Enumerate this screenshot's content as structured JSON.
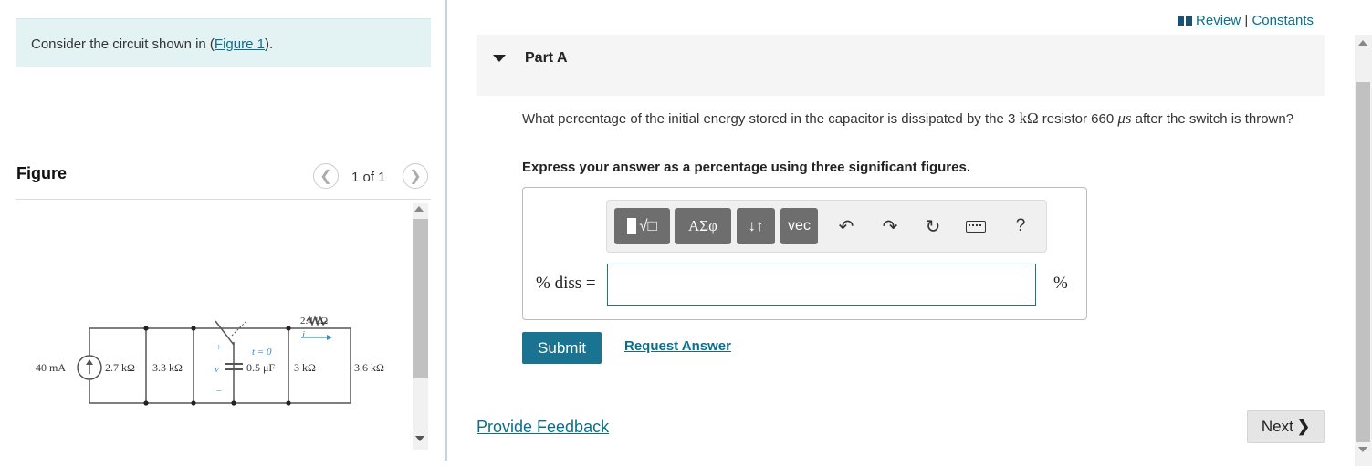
{
  "intro": {
    "prefix": "Consider the circuit shown in (",
    "link": "Figure 1",
    "suffix": ")."
  },
  "figure": {
    "title": "Figure",
    "count": "1 of 1",
    "prev_icon": "chevron-left-icon",
    "next_icon": "chevron-right-icon",
    "circuit": {
      "source": "40 mA",
      "r1": "2.7 kΩ",
      "r2": "3.3 kΩ",
      "r3": "2.4 kΩ",
      "cap": "0.5 μF",
      "r4": "3 kΩ",
      "r5": "3.6 kΩ",
      "time": "t = 0",
      "current": "i",
      "voltage": "v",
      "plus": "+",
      "minus": "−"
    }
  },
  "topnav": {
    "review": "Review",
    "sep": "|",
    "constants": "Constants"
  },
  "part": {
    "label": "Part A"
  },
  "question": {
    "text_a": "What percentage of the initial energy stored in the capacitor is dissipated by the 3 ",
    "unit_k": "kΩ",
    "text_b": " resistor 660 ",
    "unit_us": "μs",
    "text_c": " after the switch is thrown?",
    "instruction": "Express your answer as a percentage using three significant figures."
  },
  "toolbar": {
    "templates_label": "√□",
    "greek_label": "ΑΣφ",
    "arrows_label": "↓↑",
    "vec_label": "vec",
    "undo": "↶",
    "redo": "↷",
    "reset": "↻",
    "help": "?"
  },
  "answer": {
    "label": "% diss =",
    "value": "",
    "unit": "%"
  },
  "buttons": {
    "submit": "Submit",
    "request": "Request Answer",
    "next": "Next"
  },
  "feedback": "Provide Feedback",
  "colors": {
    "accent": "#1a7391",
    "intro_bg": "#e3f2f3",
    "circuit_blue": "#2f8fd0"
  }
}
